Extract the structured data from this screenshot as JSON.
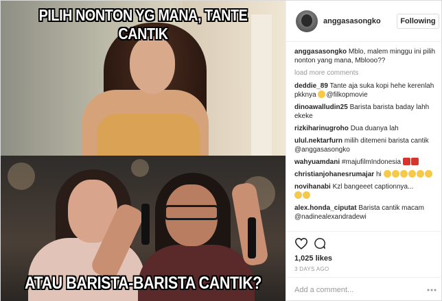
{
  "post": {
    "caption_top": "PILIH NONTON YG MANA, TANTE CANTIK",
    "caption_bottom": "ATAU BARISTA-BARISTA CANTIK?"
  },
  "header": {
    "username": "anggasasongko",
    "follow_label": "Following"
  },
  "comments": {
    "load_more": "load more comments",
    "items": [
      {
        "user": "anggasasongko",
        "text": "Mblo, malem minggu ini pilih nonton yang mana, Mblooo??"
      },
      {
        "user": "deddie_89",
        "text": "Tante aja suka kopi hehe kerenlah pkknya",
        "text2": "@filkopmovie"
      },
      {
        "user": "dinoawalludin25",
        "text": "Barista barista baday lahh ekeke"
      },
      {
        "user": "rizkiharinugroho",
        "text": "Dua duanya lah"
      },
      {
        "user": "ulul.nektarfurn",
        "text": "milih ditemeni barista cantik @anggasasongko"
      },
      {
        "user": "wahyuamdani",
        "text": "#majufilmIndonesia"
      },
      {
        "user": "christianjohanesrumajar",
        "text": "hi"
      },
      {
        "user": "novihanabi",
        "text": "Kzl bangeeet captionnya..."
      },
      {
        "user": "alex.honda_ciputat",
        "text": "Barista cantik macam @nadinealexandradewi"
      }
    ]
  },
  "actions": {
    "likes": "1,025 likes",
    "timestamp": "3 DAYS AGO",
    "comment_placeholder": "Add a comment..."
  },
  "icons": {
    "heart": "heart-icon",
    "comment": "comment-icon",
    "more": "more-icon"
  },
  "colors": {
    "muted_text": "#999999",
    "border": "#dbdbdb",
    "text": "#262626"
  }
}
